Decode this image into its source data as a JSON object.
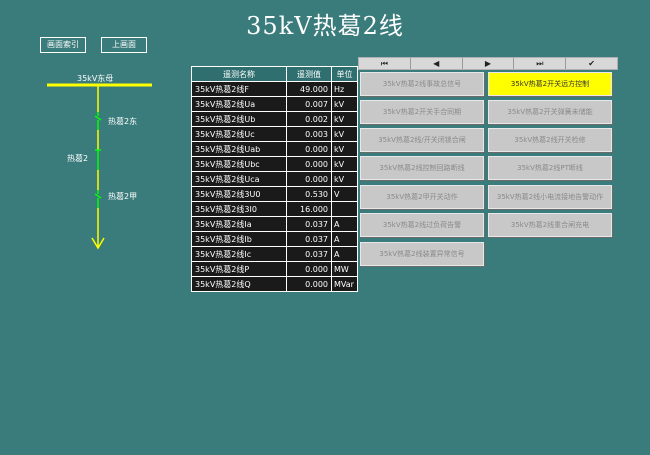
{
  "header": {
    "title": "35kV热葛2线"
  },
  "nav": {
    "home_label": "画面索引",
    "back_label": "上画面"
  },
  "diagram": {
    "bus_label": "35kV东母",
    "switch_upper_label": "热葛2东",
    "line_label": "热葛2",
    "switch_lower_label": "热葛2甲",
    "colors": {
      "bus": "#ffff00",
      "switch": "#00ff00",
      "line": "#ffff00"
    }
  },
  "table": {
    "headers": [
      "遥测名称",
      "遥测值",
      "单位"
    ],
    "rows": [
      {
        "name": "35kV热葛2线F",
        "value": "49.000",
        "unit": "Hz"
      },
      {
        "name": "35kV热葛2线Ua",
        "value": "0.007",
        "unit": "kV"
      },
      {
        "name": "35kV热葛2线Ub",
        "value": "0.002",
        "unit": "kV"
      },
      {
        "name": "35kV热葛2线Uc",
        "value": "0.003",
        "unit": "kV"
      },
      {
        "name": "35kV热葛2线Uab",
        "value": "0.000",
        "unit": "kV"
      },
      {
        "name": "35kV热葛2线Ubc",
        "value": "0.000",
        "unit": "kV"
      },
      {
        "name": "35kV热葛2线Uca",
        "value": "0.000",
        "unit": "kV"
      },
      {
        "name": "35kV热葛2线3U0",
        "value": "0.530",
        "unit": "V"
      },
      {
        "name": "35kV热葛2线3I0",
        "value": "16.000",
        "unit": ""
      },
      {
        "name": "35kV热葛2线Ia",
        "value": "0.037",
        "unit": "A"
      },
      {
        "name": "35kV热葛2线Ib",
        "value": "0.037",
        "unit": "A"
      },
      {
        "name": "35kV热葛2线Ic",
        "value": "0.037",
        "unit": "A"
      },
      {
        "name": "35kV热葛2线P",
        "value": "0.000",
        "unit": "MW"
      },
      {
        "name": "35kV热葛2线Q",
        "value": "0.000",
        "unit": "MVar"
      }
    ]
  },
  "toolbar": {
    "first_icon": "⏮",
    "prev_icon": "◀",
    "next_icon": "▶",
    "last_icon": "⏭",
    "check_icon": "✔"
  },
  "commands": [
    {
      "label": "35kV热葛2线事故总信号",
      "active": false
    },
    {
      "label": "35kV热葛2开关远方控制",
      "active": true
    },
    {
      "label": "35kV热葛2开关手合同期",
      "active": false
    },
    {
      "label": "35kV热葛2开关弹簧未储能",
      "active": false
    },
    {
      "label": "35kV热葛2线/开关闭锁合闸",
      "active": false
    },
    {
      "label": "35kV热葛2线开关检修",
      "active": false
    },
    {
      "label": "35kV热葛2线控制回路断线",
      "active": false
    },
    {
      "label": "35kV热葛2线PT断线",
      "active": false
    },
    {
      "label": "35kV热葛2甲开关动作",
      "active": false
    },
    {
      "label": "35kV热葛2线小电流接地告警动作",
      "active": false
    },
    {
      "label": "35kV热葛2线过负荷告警",
      "active": false
    },
    {
      "label": "35kV热葛2线重合闸充电",
      "active": false
    },
    {
      "label": "35kV热葛2线装置异常信号",
      "active": false
    }
  ]
}
